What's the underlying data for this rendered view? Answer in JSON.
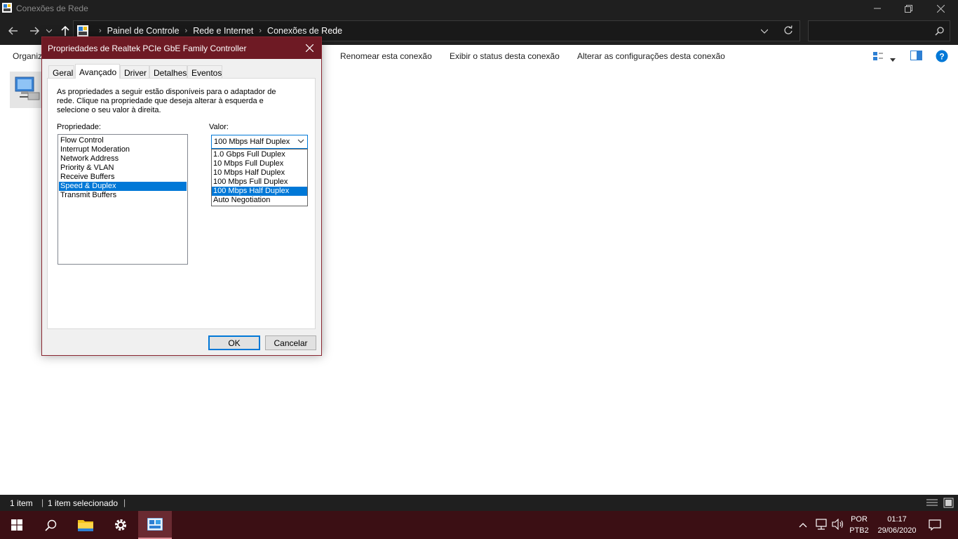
{
  "window": {
    "title": "Conexões de Rede"
  },
  "address": {
    "crumbs": [
      "Painel de Controle",
      "Rede e Internet",
      "Conexões de Rede"
    ]
  },
  "search": {
    "placeholder": ""
  },
  "commands": {
    "organize": "Organiz",
    "rename": "Renomear esta conexão",
    "status": "Exibir o status desta conexão",
    "change": "Alterar as configurações desta conexão"
  },
  "status_bar": {
    "count": "1 item",
    "selected": "1 item selecionado"
  },
  "dialog": {
    "title": "Propriedades de Realtek PCIe GbE Family Controller",
    "tabs": [
      "Geral",
      "Avançado",
      "Driver",
      "Detalhes",
      "Eventos"
    ],
    "active_tab": "Avançado",
    "description": "As propriedades a seguir estão disponíveis para o adaptador de rede. Clique na propriedade que deseja alterar à esquerda e selecione o seu valor à direita.",
    "property_label": "Propriedade:",
    "value_label": "Valor:",
    "properties": [
      "Flow Control",
      "Interrupt Moderation",
      "Network Address",
      "Priority & VLAN",
      "Receive Buffers",
      "Speed & Duplex",
      "Transmit Buffers"
    ],
    "selected_property": "Speed & Duplex",
    "current_value": "100 Mbps Half Duplex",
    "value_options": [
      "1.0 Gbps Full Duplex",
      "10 Mbps Full Duplex",
      "10 Mbps Half Duplex",
      "100 Mbps Full Duplex",
      "100 Mbps Half Duplex",
      "Auto Negotiation"
    ],
    "ok_label": "OK",
    "cancel_label": "Cancelar"
  },
  "taskbar": {
    "language": "POR",
    "layout": "PTB2",
    "time": "01:17",
    "date": "29/06/2020"
  },
  "colors": {
    "accent": "#0078d7",
    "dialog_title": "#6e1a24",
    "taskbar": "#3b0f14",
    "explorer_dark": "#1f1f1f"
  }
}
